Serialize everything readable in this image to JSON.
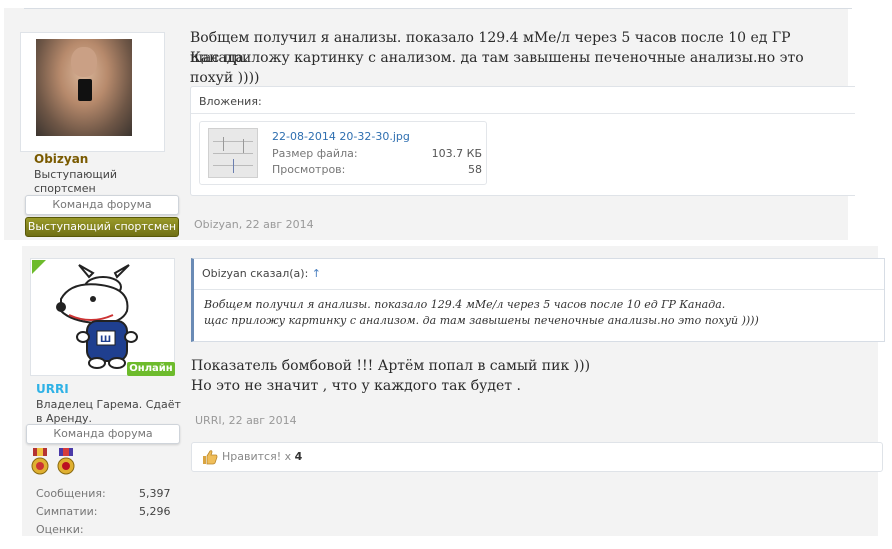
{
  "post1": {
    "username": "Obizyan",
    "user_title": "Выступающий спортсмен",
    "team_badge": "Команда форума",
    "athlete_badge": "Выступающий спортсмен",
    "message_line1": "Вобщем получил я анализы. показало 129.4 мМе/л через 5 часов после 10 ед ГР Канада.",
    "message_line2": "щас приложу картинку с анализом. да там завышены печеночные анализы.но это похуй ))))",
    "attachments_label": "Вложения:",
    "attachment": {
      "filename": "22-08-2014 20-32-30.jpg",
      "size_label": "Размер файла:",
      "size_value": "103.7 КБ",
      "views_label": "Просмотров:",
      "views_value": "58"
    },
    "meta": "Obizyan, 22 авг 2014"
  },
  "post2": {
    "username": "URRI",
    "user_title_line1": "Владелец Гарема. Сдаёт",
    "user_title_line2": "в Аренду.",
    "online_badge": "Онлайн",
    "team_badge": "Команда форума",
    "quote": {
      "author": "Obizyan сказал(а):",
      "arrow": "↑",
      "line1": "Вобщем получил я анализы. показало 129.4 мМе/л через 5 часов после 10 ед ГР Канада.",
      "line2": "щас приложу картинку с анализом. да там завышены печеночные анализы.но это похуй ))))"
    },
    "message_line1": "Показатель бомбовой !!! Артём попал в самый пик )))",
    "message_line2": "Но это не значит , что у каждого так будет .",
    "meta": "URRI, 22 авг 2014",
    "likes_label": "Нравится!",
    "likes_x": "x",
    "likes_count": "4",
    "stats": {
      "messages_label": "Сообщения:",
      "messages_value": "5,397",
      "likes_label": "Симпатии:",
      "likes_value": "5,296",
      "ratings_label": "Оценки:"
    }
  },
  "colors": {
    "username1": "#7a5a00",
    "username2": "#2fb2e6",
    "online": "#6dbb2c",
    "link": "#2f6fb0"
  }
}
